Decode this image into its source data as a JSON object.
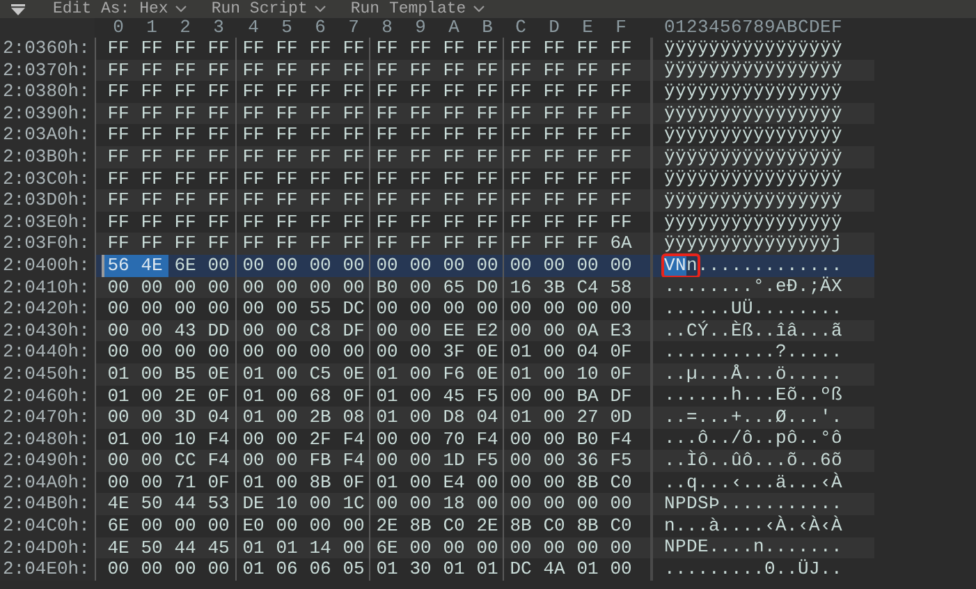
{
  "toolbar": {
    "menus": [
      {
        "label": "Edit As: Hex"
      },
      {
        "label": "Run Script"
      },
      {
        "label": "Run Template"
      }
    ]
  },
  "hex_columns": [
    "0",
    "1",
    "2",
    "3",
    "4",
    "5",
    "6",
    "7",
    "8",
    "9",
    "A",
    "B",
    "C",
    "D",
    "E",
    "F"
  ],
  "ascii_header": "0123456789ABCDEF",
  "rows": [
    {
      "offset": "2:0360h:",
      "current": false,
      "bytes": [
        "FF",
        "FF",
        "FF",
        "FF",
        "FF",
        "FF",
        "FF",
        "FF",
        "FF",
        "FF",
        "FF",
        "FF",
        "FF",
        "FF",
        "FF",
        "FF"
      ],
      "ascii": [
        {
          "text": "ÿÿÿÿÿÿÿÿÿÿÿÿÿÿÿÿ",
          "selected": false,
          "boxed": false
        }
      ]
    },
    {
      "offset": "2:0370h:",
      "current": false,
      "bytes": [
        "FF",
        "FF",
        "FF",
        "FF",
        "FF",
        "FF",
        "FF",
        "FF",
        "FF",
        "FF",
        "FF",
        "FF",
        "FF",
        "FF",
        "FF",
        "FF"
      ],
      "ascii": [
        {
          "text": "ÿÿÿÿÿÿÿÿÿÿÿÿÿÿÿÿ",
          "selected": false,
          "boxed": false
        }
      ]
    },
    {
      "offset": "2:0380h:",
      "current": false,
      "bytes": [
        "FF",
        "FF",
        "FF",
        "FF",
        "FF",
        "FF",
        "FF",
        "FF",
        "FF",
        "FF",
        "FF",
        "FF",
        "FF",
        "FF",
        "FF",
        "FF"
      ],
      "ascii": [
        {
          "text": "ÿÿÿÿÿÿÿÿÿÿÿÿÿÿÿÿ",
          "selected": false,
          "boxed": false
        }
      ]
    },
    {
      "offset": "2:0390h:",
      "current": false,
      "bytes": [
        "FF",
        "FF",
        "FF",
        "FF",
        "FF",
        "FF",
        "FF",
        "FF",
        "FF",
        "FF",
        "FF",
        "FF",
        "FF",
        "FF",
        "FF",
        "FF"
      ],
      "ascii": [
        {
          "text": "ÿÿÿÿÿÿÿÿÿÿÿÿÿÿÿÿ",
          "selected": false,
          "boxed": false
        }
      ]
    },
    {
      "offset": "2:03A0h:",
      "current": false,
      "bytes": [
        "FF",
        "FF",
        "FF",
        "FF",
        "FF",
        "FF",
        "FF",
        "FF",
        "FF",
        "FF",
        "FF",
        "FF",
        "FF",
        "FF",
        "FF",
        "FF"
      ],
      "ascii": [
        {
          "text": "ÿÿÿÿÿÿÿÿÿÿÿÿÿÿÿÿ",
          "selected": false,
          "boxed": false
        }
      ]
    },
    {
      "offset": "2:03B0h:",
      "current": false,
      "bytes": [
        "FF",
        "FF",
        "FF",
        "FF",
        "FF",
        "FF",
        "FF",
        "FF",
        "FF",
        "FF",
        "FF",
        "FF",
        "FF",
        "FF",
        "FF",
        "FF"
      ],
      "ascii": [
        {
          "text": "ÿÿÿÿÿÿÿÿÿÿÿÿÿÿÿÿ",
          "selected": false,
          "boxed": false
        }
      ]
    },
    {
      "offset": "2:03C0h:",
      "current": false,
      "bytes": [
        "FF",
        "FF",
        "FF",
        "FF",
        "FF",
        "FF",
        "FF",
        "FF",
        "FF",
        "FF",
        "FF",
        "FF",
        "FF",
        "FF",
        "FF",
        "FF"
      ],
      "ascii": [
        {
          "text": "ÿÿÿÿÿÿÿÿÿÿÿÿÿÿÿÿ",
          "selected": false,
          "boxed": false
        }
      ]
    },
    {
      "offset": "2:03D0h:",
      "current": false,
      "bytes": [
        "FF",
        "FF",
        "FF",
        "FF",
        "FF",
        "FF",
        "FF",
        "FF",
        "FF",
        "FF",
        "FF",
        "FF",
        "FF",
        "FF",
        "FF",
        "FF"
      ],
      "ascii": [
        {
          "text": "ÿÿÿÿÿÿÿÿÿÿÿÿÿÿÿÿ",
          "selected": false,
          "boxed": false
        }
      ]
    },
    {
      "offset": "2:03E0h:",
      "current": false,
      "bytes": [
        "FF",
        "FF",
        "FF",
        "FF",
        "FF",
        "FF",
        "FF",
        "FF",
        "FF",
        "FF",
        "FF",
        "FF",
        "FF",
        "FF",
        "FF",
        "FF"
      ],
      "ascii": [
        {
          "text": "ÿÿÿÿÿÿÿÿÿÿÿÿÿÿÿÿ",
          "selected": false,
          "boxed": false
        }
      ]
    },
    {
      "offset": "2:03F0h:",
      "current": false,
      "bytes": [
        "FF",
        "FF",
        "FF",
        "FF",
        "FF",
        "FF",
        "FF",
        "FF",
        "FF",
        "FF",
        "FF",
        "FF",
        "FF",
        "FF",
        "FF",
        "6A"
      ],
      "ascii": [
        {
          "text": "ÿÿÿÿÿÿÿÿÿÿÿÿÿÿÿj",
          "selected": false,
          "boxed": false
        }
      ]
    },
    {
      "offset": "2:0400h:",
      "current": true,
      "bytes": [
        "56",
        "4E",
        "6E",
        "00",
        "00",
        "00",
        "00",
        "00",
        "00",
        "00",
        "00",
        "00",
        "00",
        "00",
        "00",
        "00"
      ],
      "ascii": [
        {
          "text": "VN",
          "selected": true,
          "boxed": true
        },
        {
          "text": "n",
          "selected": false,
          "boxed": true
        },
        {
          "text": ".............",
          "selected": false,
          "boxed": false
        }
      ]
    },
    {
      "offset": "2:0410h:",
      "current": false,
      "bytes": [
        "00",
        "00",
        "00",
        "00",
        "00",
        "00",
        "00",
        "00",
        "B0",
        "00",
        "65",
        "D0",
        "16",
        "3B",
        "C4",
        "58"
      ],
      "ascii": [
        {
          "text": "........°.eÐ.;ÄX",
          "selected": false,
          "boxed": false
        }
      ]
    },
    {
      "offset": "2:0420h:",
      "current": false,
      "bytes": [
        "00",
        "00",
        "00",
        "00",
        "00",
        "00",
        "55",
        "DC",
        "00",
        "00",
        "00",
        "00",
        "00",
        "00",
        "00",
        "00"
      ],
      "ascii": [
        {
          "text": "......UÜ........",
          "selected": false,
          "boxed": false
        }
      ]
    },
    {
      "offset": "2:0430h:",
      "current": false,
      "bytes": [
        "00",
        "00",
        "43",
        "DD",
        "00",
        "00",
        "C8",
        "DF",
        "00",
        "00",
        "EE",
        "E2",
        "00",
        "00",
        "0A",
        "E3"
      ],
      "ascii": [
        {
          "text": "..CÝ..Èß..îâ...ã",
          "selected": false,
          "boxed": false
        }
      ]
    },
    {
      "offset": "2:0440h:",
      "current": false,
      "bytes": [
        "00",
        "00",
        "00",
        "00",
        "00",
        "00",
        "00",
        "00",
        "00",
        "00",
        "3F",
        "0E",
        "01",
        "00",
        "04",
        "0F"
      ],
      "ascii": [
        {
          "text": "..........?.....",
          "selected": false,
          "boxed": false
        }
      ]
    },
    {
      "offset": "2:0450h:",
      "current": false,
      "bytes": [
        "01",
        "00",
        "B5",
        "0E",
        "01",
        "00",
        "C5",
        "0E",
        "01",
        "00",
        "F6",
        "0E",
        "01",
        "00",
        "10",
        "0F"
      ],
      "ascii": [
        {
          "text": "..µ...Å...ö.....",
          "selected": false,
          "boxed": false
        }
      ]
    },
    {
      "offset": "2:0460h:",
      "current": false,
      "bytes": [
        "01",
        "00",
        "2E",
        "0F",
        "01",
        "00",
        "68",
        "0F",
        "01",
        "00",
        "45",
        "F5",
        "00",
        "00",
        "BA",
        "DF"
      ],
      "ascii": [
        {
          "text": "......h...Eõ..ºß",
          "selected": false,
          "boxed": false
        }
      ]
    },
    {
      "offset": "2:0470h:",
      "current": false,
      "bytes": [
        "00",
        "00",
        "3D",
        "04",
        "01",
        "00",
        "2B",
        "08",
        "01",
        "00",
        "D8",
        "04",
        "01",
        "00",
        "27",
        "0D"
      ],
      "ascii": [
        {
          "text": "..=...+...Ø...'.",
          "selected": false,
          "boxed": false
        }
      ]
    },
    {
      "offset": "2:0480h:",
      "current": false,
      "bytes": [
        "01",
        "00",
        "10",
        "F4",
        "00",
        "00",
        "2F",
        "F4",
        "00",
        "00",
        "70",
        "F4",
        "00",
        "00",
        "B0",
        "F4"
      ],
      "ascii": [
        {
          "text": "...ô../ô..pô..°ô",
          "selected": false,
          "boxed": false
        }
      ]
    },
    {
      "offset": "2:0490h:",
      "current": false,
      "bytes": [
        "00",
        "00",
        "CC",
        "F4",
        "00",
        "00",
        "FB",
        "F4",
        "00",
        "00",
        "1D",
        "F5",
        "00",
        "00",
        "36",
        "F5"
      ],
      "ascii": [
        {
          "text": "..Ìô..ûô...õ..6õ",
          "selected": false,
          "boxed": false
        }
      ]
    },
    {
      "offset": "2:04A0h:",
      "current": false,
      "bytes": [
        "00",
        "00",
        "71",
        "0F",
        "01",
        "00",
        "8B",
        "0F",
        "01",
        "00",
        "E4",
        "00",
        "00",
        "00",
        "8B",
        "C0"
      ],
      "ascii": [
        {
          "text": "..q...‹...ä...‹À",
          "selected": false,
          "boxed": false
        }
      ]
    },
    {
      "offset": "2:04B0h:",
      "current": false,
      "bytes": [
        "4E",
        "50",
        "44",
        "53",
        "DE",
        "10",
        "00",
        "1C",
        "00",
        "00",
        "18",
        "00",
        "00",
        "00",
        "00",
        "00"
      ],
      "ascii": [
        {
          "text": "NPDSÞ...........",
          "selected": false,
          "boxed": false
        }
      ]
    },
    {
      "offset": "2:04C0h:",
      "current": false,
      "bytes": [
        "6E",
        "00",
        "00",
        "00",
        "E0",
        "00",
        "00",
        "00",
        "2E",
        "8B",
        "C0",
        "2E",
        "8B",
        "C0",
        "8B",
        "C0"
      ],
      "ascii": [
        {
          "text": "n...à....‹À.‹À‹À",
          "selected": false,
          "boxed": false
        }
      ]
    },
    {
      "offset": "2:04D0h:",
      "current": false,
      "bytes": [
        "4E",
        "50",
        "44",
        "45",
        "01",
        "01",
        "14",
        "00",
        "6E",
        "00",
        "00",
        "00",
        "00",
        "00",
        "00",
        "00"
      ],
      "ascii": [
        {
          "text": "NPDE....n.......",
          "selected": false,
          "boxed": false
        }
      ]
    },
    {
      "offset": "2:04E0h:",
      "current": false,
      "bytes": [
        "00",
        "00",
        "00",
        "00",
        "01",
        "06",
        "06",
        "05",
        "01",
        "30",
        "01",
        "01",
        "DC",
        "4A",
        "01",
        "00"
      ],
      "ascii": [
        {
          "text": ".........0..ÜJ..",
          "selected": false,
          "boxed": false
        }
      ]
    }
  ]
}
